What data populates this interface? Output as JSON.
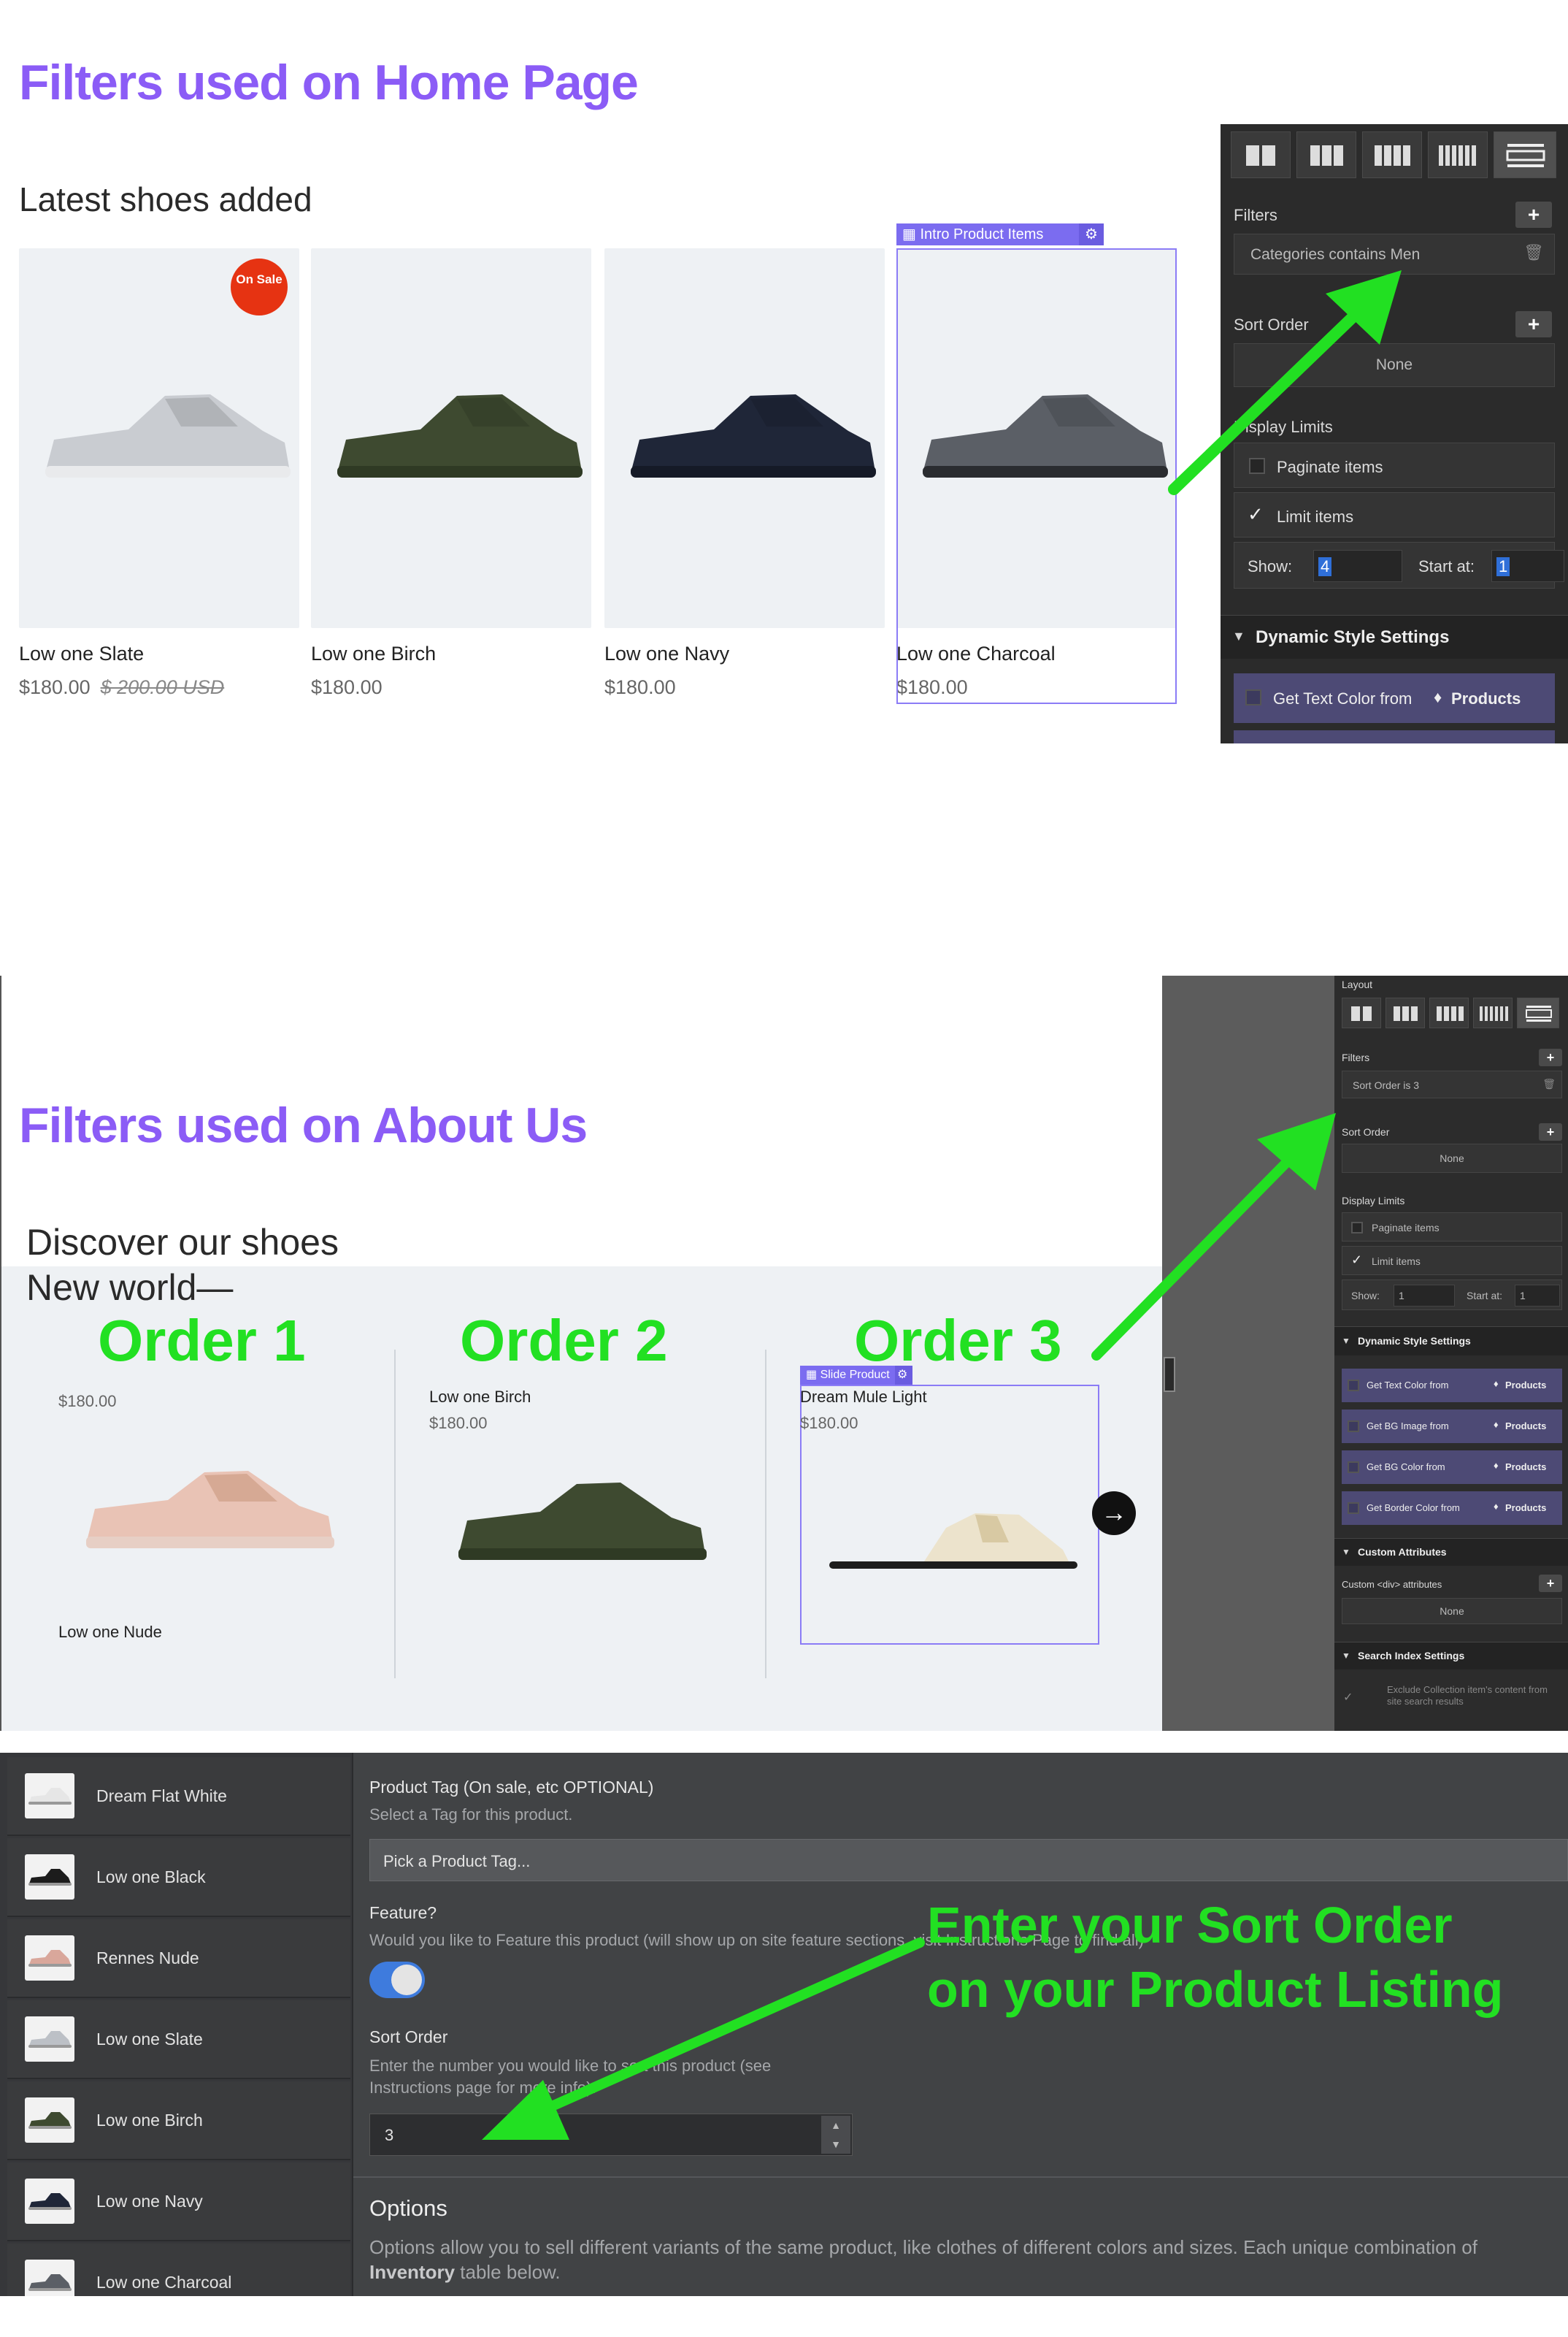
{
  "section1": {
    "title": "Filters used on Home Page",
    "heading": "Latest shoes added",
    "products": [
      {
        "name": "Low one Slate",
        "price": "$180.00",
        "old_price": "$ 200.00 USD",
        "badge": "On Sale",
        "color": "#c9ccd1",
        "sole": "#e9eaec"
      },
      {
        "name": "Low one Birch",
        "price": "$180.00",
        "color": "#3e4a30",
        "sole": "#2f3a24"
      },
      {
        "name": "Low one Navy",
        "price": "$180.00",
        "color": "#1f2638",
        "sole": "#151a27"
      },
      {
        "name": "Low one Charcoal",
        "price": "$180.00",
        "color": "#5b5f66",
        "sole": "#2a2c30"
      }
    ],
    "selection_tag": "Intro Product Items",
    "panel": {
      "filters_label": "Filters",
      "filter_value": "Categories contains Men",
      "sort_label": "Sort Order",
      "sort_value": "None",
      "display_label": "Display Limits",
      "paginate_label": "Paginate items",
      "limit_label": "Limit items",
      "show_label": "Show:",
      "show_value": "4",
      "start_label": "Start at:",
      "start_value": "1",
      "dynamic_label": "Dynamic Style Settings",
      "text_color_label": "Get Text Color from",
      "products_tag": "Products"
    }
  },
  "section2": {
    "title": "Filters used on About Us",
    "heading_line1": "Discover our shoes",
    "heading_line2": "New world—",
    "orders": [
      "Order 1",
      "Order 2",
      "Order 3"
    ],
    "slides": [
      {
        "price": "$180.00",
        "name": "Low one Nude"
      },
      {
        "name": "Low one Birch",
        "price": "$180.00"
      },
      {
        "name": "Dream Mule Light",
        "price": "$180.00"
      }
    ],
    "slide_tag": "Slide Product",
    "panel": {
      "layout_label": "Layout",
      "filters_label": "Filters",
      "filter_value": "Sort Order is 3",
      "sort_label": "Sort Order",
      "sort_value": "None",
      "display_label": "Display Limits",
      "paginate_label": "Paginate items",
      "limit_label": "Limit items",
      "show_label": "Show:",
      "show_value": "1",
      "start_label": "Start at:",
      "start_value": "1",
      "dynamic_label": "Dynamic Style Settings",
      "dyn_rows": [
        "Get Text Color from",
        "Get BG Image from",
        "Get BG Color from",
        "Get Border Color from"
      ],
      "products_tag": "Products",
      "custom_attr_label": "Custom Attributes",
      "custom_div_label": "Custom <div> attributes",
      "custom_div_value": "None",
      "search_label": "Search Index Settings",
      "exclude_label": "Exclude Collection item's content from site search results"
    }
  },
  "section3": {
    "list": [
      {
        "name": "Dream Flat White",
        "color": "#e6e6e6"
      },
      {
        "name": "Low one Black",
        "color": "#1c1c1c"
      },
      {
        "name": "Rennes Nude",
        "color": "#d9a79b"
      },
      {
        "name": "Low one Slate",
        "color": "#bcc0c6"
      },
      {
        "name": "Low one Birch",
        "color": "#3e4a30"
      },
      {
        "name": "Low one Navy",
        "color": "#1f2638"
      },
      {
        "name": "Low one Charcoal",
        "color": "#5b5f66"
      }
    ],
    "tag_label": "Product Tag (On sale, etc OPTIONAL)",
    "tag_help": "Select a Tag for this product.",
    "tag_placeholder": "Pick a Product Tag...",
    "feature_label": "Feature?",
    "feature_help": "Would you like to Feature this product (will show up on site feature sections, visit Instructions Page to find all)",
    "sort_label": "Sort Order",
    "sort_help": "Enter the number you would like to sort this product (see Instructions page for more info).",
    "sort_value": "3",
    "options_label": "Options",
    "options_help_1": "Options allow you to sell different variants of the same product, like clothes of different colors and sizes. Each unique combination of",
    "options_help_bold": "Inventory",
    "options_help_2": "table below.",
    "annotation_line1": "Enter your Sort Order",
    "annotation_line2": "on your Product Listing"
  }
}
